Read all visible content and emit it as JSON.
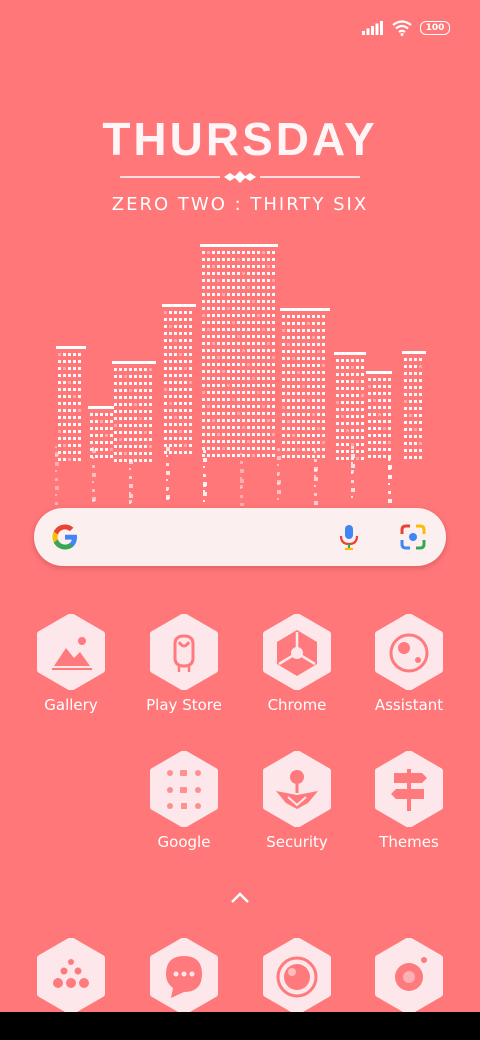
{
  "status": {
    "battery": "100"
  },
  "clock": {
    "day": "THURSDAY",
    "time": "ZERO TWO : THIRTY SIX"
  },
  "apps_row1": [
    {
      "label": "Gallery"
    },
    {
      "label": "Play Store"
    },
    {
      "label": "Chrome"
    },
    {
      "label": "Assistant"
    }
  ],
  "apps_row2": [
    {
      "label": "Google"
    },
    {
      "label": "Security"
    },
    {
      "label": "Themes"
    }
  ],
  "dock": [
    {
      "icon": "apps-icon"
    },
    {
      "icon": "messages-icon"
    },
    {
      "icon": "browser-icon"
    },
    {
      "icon": "camera-icon"
    }
  ],
  "colors": {
    "background": "#ff7779",
    "icon_fill": "#fde7ea",
    "icon_glyph": "#ff7a7d"
  }
}
